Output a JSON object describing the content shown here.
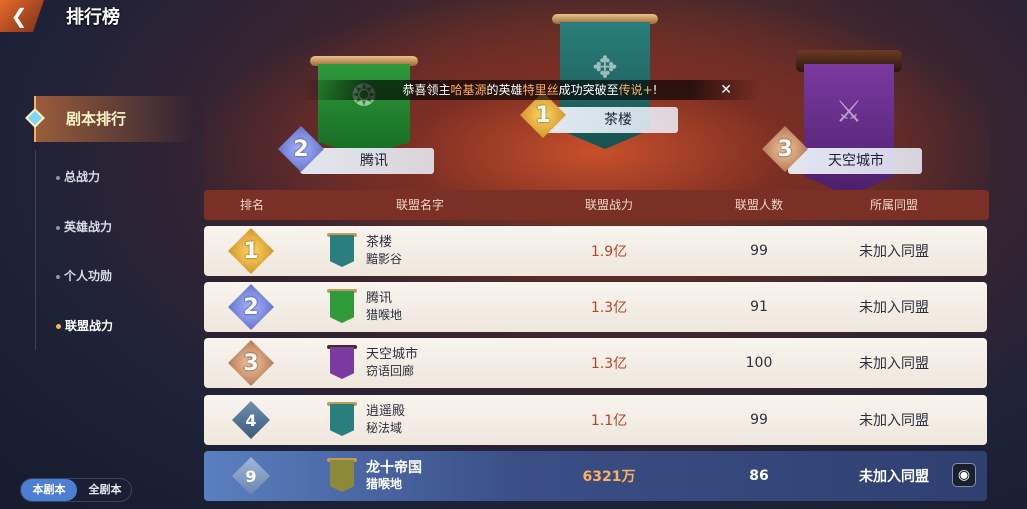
{
  "header": {
    "title": "排行榜",
    "back_icon": "back-arrow-icon"
  },
  "sidenav": {
    "main": "剧本排行",
    "items": [
      {
        "label": "总战力",
        "active": false
      },
      {
        "label": "英雄战力",
        "active": false
      },
      {
        "label": "个人功勋",
        "active": false
      },
      {
        "label": "联盟战力",
        "active": true
      }
    ]
  },
  "toggle": {
    "current": "本剧本",
    "all": "全剧本"
  },
  "notice": {
    "prefix": "恭喜领主",
    "player": "哈基源",
    "mid": "的英雄",
    "hero": "特里丝",
    "action": "成功突破至",
    "tier": "传说+",
    "suffix": "!"
  },
  "podium": [
    {
      "rank": "1",
      "name": "茶楼",
      "banner_color": "#2a7f7c"
    },
    {
      "rank": "2",
      "name": "腾讯",
      "banner_color": "#2e9a3a"
    },
    {
      "rank": "3",
      "name": "天空城市",
      "banner_color": "#7b3aa0"
    }
  ],
  "table": {
    "headers": {
      "rank": "排名",
      "name": "联盟名字",
      "power": "联盟战力",
      "members": "联盟人数",
      "affiliation": "所属同盟"
    },
    "rows": [
      {
        "rank": "1",
        "name": "茶楼",
        "server": "黯影谷",
        "power": "1.9亿",
        "members": "99",
        "affiliation": "未加入同盟",
        "flag_color": "#2a7f7c"
      },
      {
        "rank": "2",
        "name": "腾讯",
        "server": "猎喉地",
        "power": "1.3亿",
        "members": "91",
        "affiliation": "未加入同盟",
        "flag_color": "#2e9a3a"
      },
      {
        "rank": "3",
        "name": "天空城市",
        "server": "窃语回廊",
        "power": "1.3亿",
        "members": "100",
        "affiliation": "未加入同盟",
        "flag_color": "#7b3aa0"
      },
      {
        "rank": "4",
        "name": "逍遥殿",
        "server": "秘法域",
        "power": "1.1亿",
        "members": "99",
        "affiliation": "未加入同盟",
        "flag_color": "#2a7f7c"
      }
    ],
    "my_row": {
      "rank": "9",
      "name": "龙十帝国",
      "server": "猎喉地",
      "power": "6321万",
      "members": "86",
      "affiliation": "未加入同盟",
      "flag_color": "#8a8a3a"
    }
  }
}
